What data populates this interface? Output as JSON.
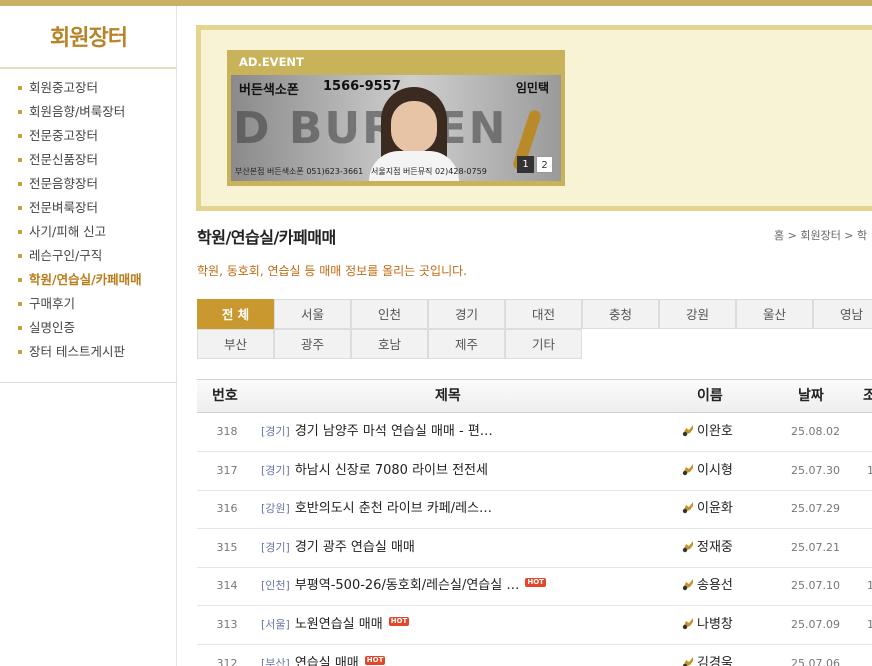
{
  "sidebar": {
    "title": "회원장터",
    "items": [
      {
        "label": "회원중고장터"
      },
      {
        "label": "회원음향/벼룩장터"
      },
      {
        "label": "전문중고장터"
      },
      {
        "label": "전문신품장터"
      },
      {
        "label": "전문음향장터"
      },
      {
        "label": "전문벼룩장터"
      },
      {
        "label": "사기/피해 신고"
      },
      {
        "label": "레슨구인/구직"
      },
      {
        "label": "학원/연습실/카페매매"
      },
      {
        "label": "구매후기"
      },
      {
        "label": "실명인증"
      },
      {
        "label": "장터 테스트게시판"
      }
    ],
    "active_index": 8
  },
  "ad": {
    "label": "AD.EVENT",
    "brand": "버든색소폰",
    "phone": "1566-9557",
    "person": "임민택",
    "big_text": "D BURDEN",
    "footer_left": "부산본점  버든색소폰  051)623-3661",
    "footer_right": "서울지점  버든뮤직  02)428-0759",
    "pages": [
      "1",
      "2"
    ]
  },
  "page": {
    "title": "학원/연습실/카페매매",
    "breadcrumb": "홈 > 회원장터 > 학",
    "description": "학원, 동호회, 연습실 등 매매 정보를 올리는 곳입니다."
  },
  "tabs": [
    "전 체",
    "서울",
    "인천",
    "경기",
    "대전",
    "충청",
    "강원",
    "울산",
    "영남",
    "부산",
    "광주",
    "호남",
    "제주",
    "기타"
  ],
  "board": {
    "headers": {
      "num": "번호",
      "subject": "제목",
      "name": "이름",
      "date": "날짜",
      "hits": "조"
    },
    "rows": [
      {
        "num": "318",
        "cat": "[경기]",
        "subject": "경기 남양주 마석 연습실 매매 - 편…",
        "hot": "",
        "name": "이완호",
        "date": "25.08.02",
        "hits": ""
      },
      {
        "num": "317",
        "cat": "[경기]",
        "subject": "하남시 신장로 7080 라이브 전전세",
        "hot": "",
        "name": "이시형",
        "date": "25.07.30",
        "hits": "1"
      },
      {
        "num": "316",
        "cat": "[강원]",
        "subject": "호반의도시 춘천 라이브 카페/레스…",
        "hot": "",
        "name": "이윤화",
        "date": "25.07.29",
        "hits": ""
      },
      {
        "num": "315",
        "cat": "[경기]",
        "subject": "경기 광주 연습실 매매",
        "hot": "",
        "name": "정재중",
        "date": "25.07.21",
        "hits": ""
      },
      {
        "num": "314",
        "cat": "[인천]",
        "subject": "부평역-500-26/동호회/레슨실/연습실 …",
        "hot": "HOT",
        "name": "송용선",
        "date": "25.07.10",
        "hits": "1"
      },
      {
        "num": "313",
        "cat": "[서울]",
        "subject": "노원연습실 매매",
        "hot": "HOT",
        "name": "나병창",
        "date": "25.07.09",
        "hits": "1"
      },
      {
        "num": "312",
        "cat": "[부산]",
        "subject": "연습실 매매",
        "hot": "HOT",
        "name": "김경욱",
        "date": "25.07.06",
        "hits": ""
      }
    ]
  }
}
